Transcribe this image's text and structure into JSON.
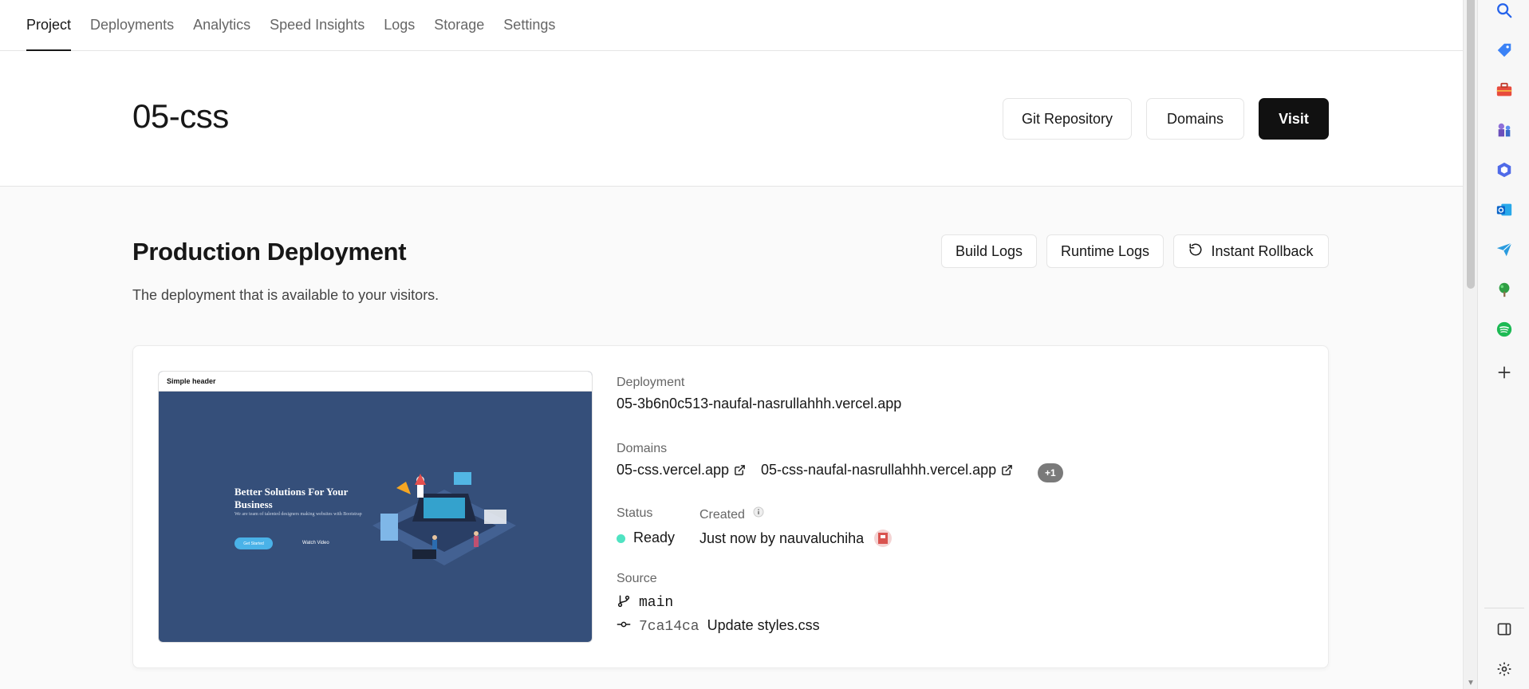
{
  "tabs": [
    {
      "label": "Project",
      "active": true
    },
    {
      "label": "Deployments"
    },
    {
      "label": "Analytics"
    },
    {
      "label": "Speed Insights"
    },
    {
      "label": "Logs"
    },
    {
      "label": "Storage"
    },
    {
      "label": "Settings"
    }
  ],
  "project": {
    "title": "05-css",
    "git_label": "Git Repository",
    "domains_label": "Domains",
    "visit_label": "Visit"
  },
  "production": {
    "title": "Production Deployment",
    "subtitle": "The deployment that is available to your visitors.",
    "build_logs_label": "Build Logs",
    "runtime_logs_label": "Runtime Logs",
    "rollback_label": "Instant Rollback"
  },
  "preview": {
    "header": "Simple header",
    "heading": "Better Solutions For Your Business",
    "text": "We are team of talented designers making websites with Bootstrap",
    "cta": "Get Started",
    "link": "Watch Video"
  },
  "deployment": {
    "label": "Deployment",
    "url": "05-3b6n0c513-naufal-nasrullahhh.vercel.app",
    "domains_label": "Domains",
    "domain_1": "05-css.vercel.app",
    "domain_2": "05-css-naufal-nasrullahhh.vercel.app",
    "domains_more": "+1",
    "status_label": "Status",
    "status": "Ready",
    "status_color": "#50e3c2",
    "created_label": "Created",
    "created": "Just now by nauvaluchiha",
    "source_label": "Source",
    "branch": "main",
    "commit_hash": "7ca14ca",
    "commit_message": "Update styles.css"
  },
  "rail": {
    "icons": [
      "search-icon",
      "tag-icon",
      "briefcase-icon",
      "chess-icon",
      "copilot-icon",
      "outlook-icon",
      "send-icon",
      "tree-icon",
      "spotify-icon",
      "add-icon",
      "sidebar-toggle-icon",
      "settings-icon"
    ]
  }
}
